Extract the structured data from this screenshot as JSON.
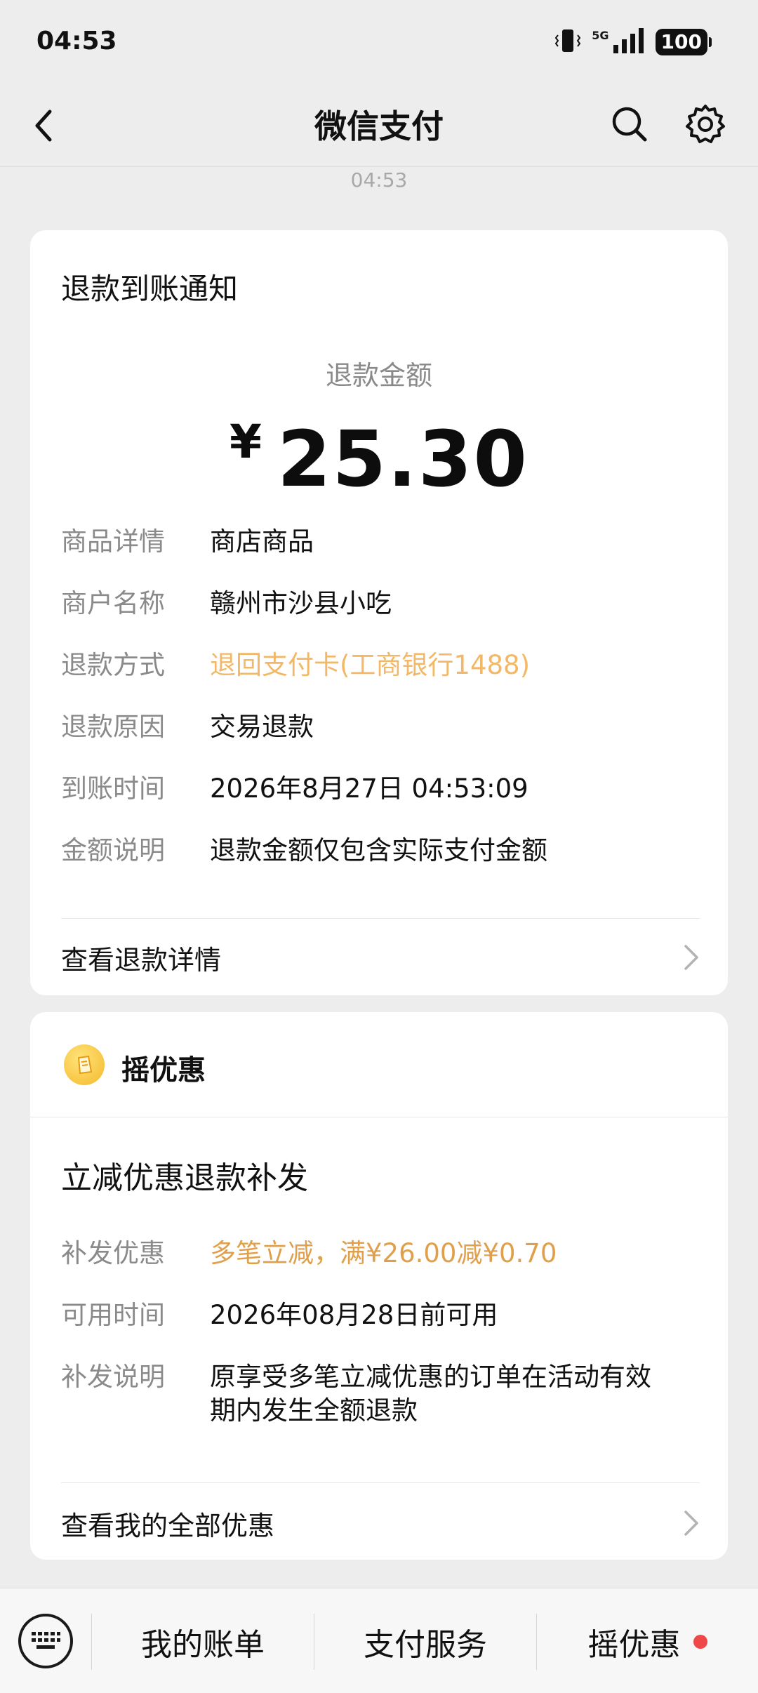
{
  "status_bar": {
    "time": "04:53",
    "network": "5G",
    "battery": "100"
  },
  "nav": {
    "title": "微信支付",
    "back_icon": "back-arrow-icon",
    "search_icon": "search-icon",
    "settings_icon": "gear-icon"
  },
  "message_time": "04:53",
  "refund_card": {
    "title": "退款到账通知",
    "amount_label": "退款金额",
    "currency": "¥",
    "amount": "25.30",
    "details": [
      {
        "key": "商品详情",
        "value": "商店商品"
      },
      {
        "key": "商户名称",
        "value": "赣州市沙县小吃"
      },
      {
        "key": "退款方式",
        "value": "退回支付卡(工商银行1488)"
      },
      {
        "key": "退款原因",
        "value": "交易退款"
      },
      {
        "key": "到账时间",
        "value": "2026年8月27日 04:53:09"
      },
      {
        "key": "金额说明",
        "value": "退款金额仅包含实际支付金额"
      }
    ],
    "link": "查看退款详情"
  },
  "promo_card": {
    "header": "摇优惠",
    "title": "立减优惠退款补发",
    "details": [
      {
        "key": "补发优惠",
        "value": "多笔立减，满¥26.00减¥0.70"
      },
      {
        "key": "可用时间",
        "value": "2026年08月28日前可用"
      },
      {
        "key": "补发说明",
        "value": "原享受多笔立减优惠的订单在活动有效期内发生全额退款"
      }
    ],
    "link": "查看我的全部优惠"
  },
  "bottom_bar": {
    "tabs": [
      {
        "label": "我的账单"
      },
      {
        "label": "支付服务"
      },
      {
        "label": "摇优惠"
      }
    ]
  },
  "colors": {
    "accent_orange": "#f2b867",
    "promo_orange": "#e0a04b",
    "red_dot": "#f04848"
  }
}
